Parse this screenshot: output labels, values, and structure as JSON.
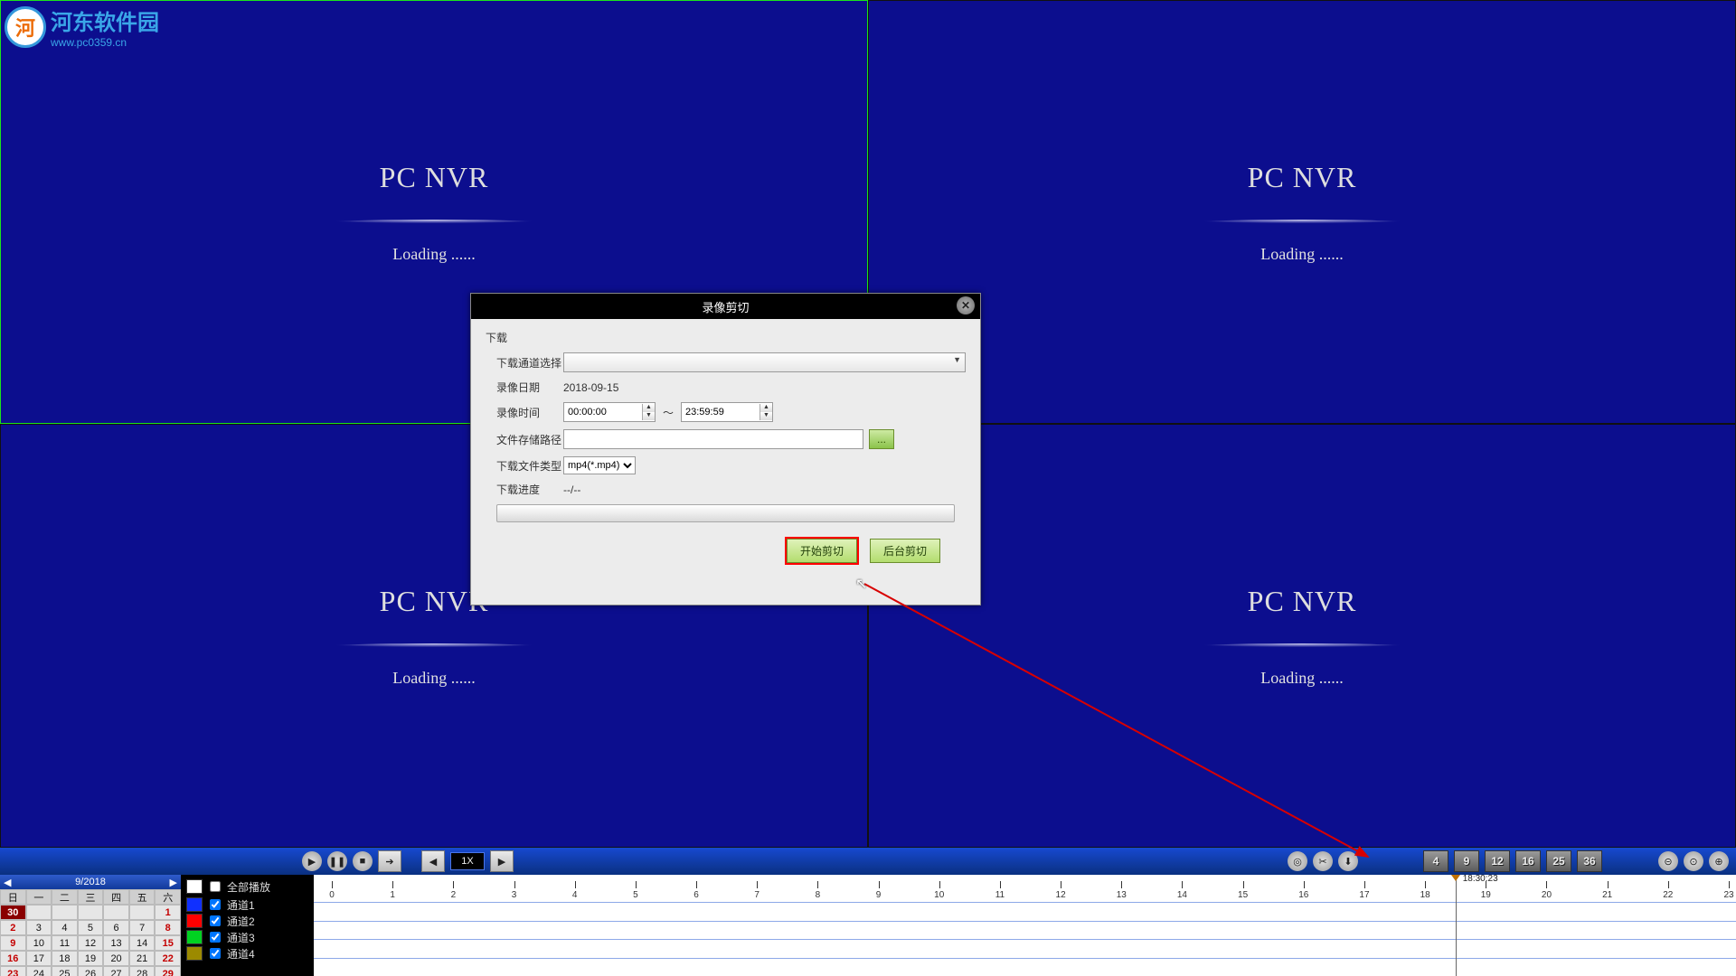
{
  "watermark": {
    "name": "河东软件园",
    "url": "www.pc0359.cn"
  },
  "cells": {
    "title": "PC   NVR",
    "loading": "Loading ......"
  },
  "modal": {
    "title": "录像剪切",
    "group": "下载",
    "channel_label": "下载通道选择",
    "date_label": "录像日期",
    "date_value": "2018-09-15",
    "time_label": "录像时间",
    "time_from": "00:00:00",
    "time_to": "23:59:59",
    "tilde": "～",
    "path_label": "文件存储路径",
    "path_btn": "...",
    "type_label": "下载文件类型",
    "type_value": "mp4(*.mp4)",
    "progress_label": "下载进度",
    "progress_value": "--/--",
    "btn_start": "开始剪切",
    "btn_back": "后台剪切"
  },
  "controls": {
    "speed": "1X",
    "grids": [
      "4",
      "9",
      "12",
      "16",
      "25",
      "36"
    ]
  },
  "calendar": {
    "month": "9/2018",
    "dow": [
      "日",
      "一",
      "二",
      "三",
      "四",
      "五",
      "六"
    ],
    "rows": [
      [
        "30",
        "",
        "",
        "",
        "",
        "",
        "1"
      ],
      [
        "2",
        "3",
        "4",
        "5",
        "6",
        "7",
        "8"
      ],
      [
        "9",
        "10",
        "11",
        "12",
        "13",
        "14",
        "15"
      ],
      [
        "16",
        "17",
        "18",
        "19",
        "20",
        "21",
        "22"
      ],
      [
        "23",
        "24",
        "25",
        "26",
        "27",
        "28",
        "29"
      ]
    ]
  },
  "legend": {
    "all": "全部播放",
    "items": [
      "通道1",
      "通道2",
      "通道3",
      "通道4"
    ],
    "colors": [
      "#1030ff",
      "#ff0000",
      "#00d221",
      "#9c8a00"
    ]
  },
  "timeline": {
    "hours": [
      "0",
      "1",
      "2",
      "3",
      "4",
      "5",
      "6",
      "7",
      "8",
      "9",
      "10",
      "11",
      "12",
      "13",
      "14",
      "15",
      "16",
      "17",
      "18",
      "19",
      "20",
      "21",
      "22",
      "23"
    ],
    "marker_time": "18:30:23"
  }
}
